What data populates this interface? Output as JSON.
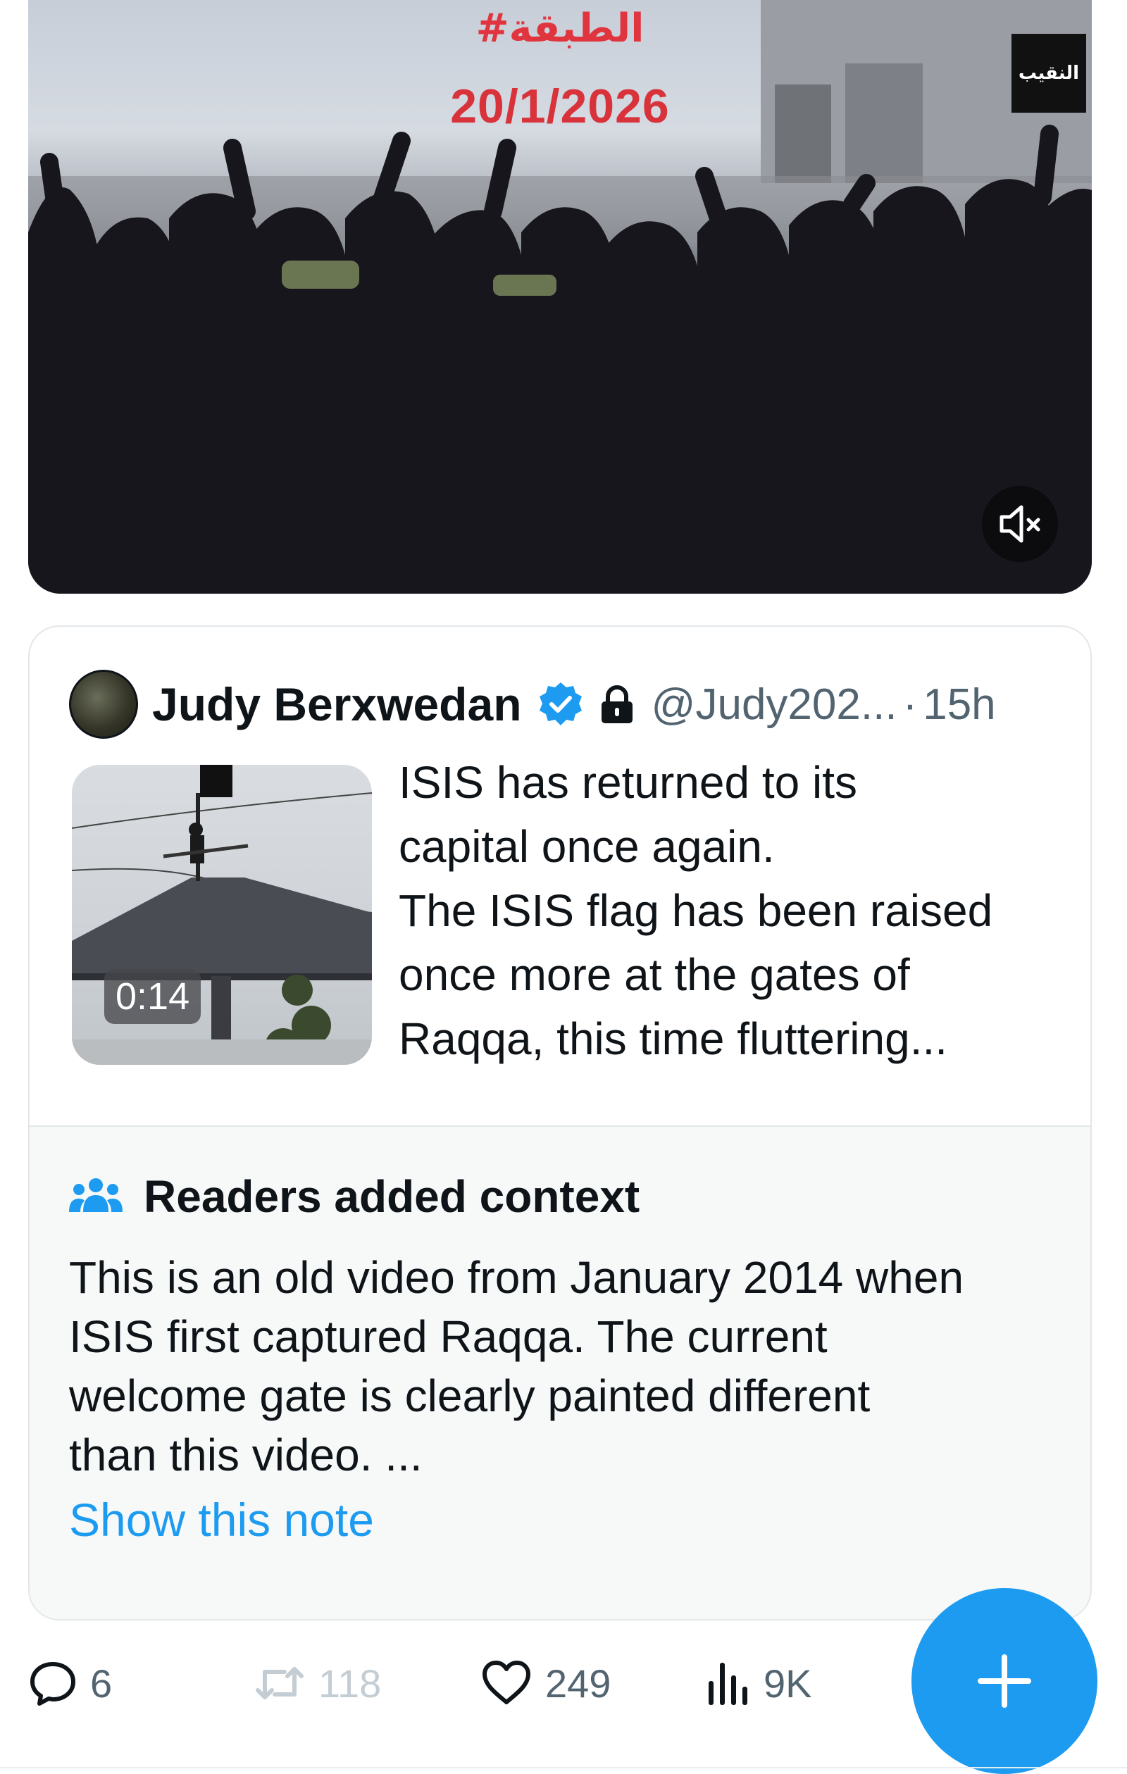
{
  "video": {
    "hashtag": "#الطبقة",
    "date": "20/1/2026",
    "channel_logo": "النقيب",
    "mute_icon": "speaker-muted-icon"
  },
  "quoted_tweet": {
    "author_name": "Judy Berxwedan",
    "verified_icon": "verified-badge-icon",
    "lock_icon": "lock-icon",
    "handle": "@Judy202...",
    "separator": "·",
    "age": "15h",
    "thumbnail_duration": "0:14",
    "text": "ISIS has returned to its\ncapital once again.\nThe ISIS flag has been raised\nonce more at the gates of\nRaqqa, this time fluttering..."
  },
  "community_note": {
    "icon": "people-icon",
    "title": "Readers added context",
    "body": "This is an old video from January 2014 when\nISIS first captured Raqqa. The current\nwelcome gate is clearly painted different\nthan this video. ...",
    "link": "Show this note"
  },
  "actions": {
    "replies": "6",
    "reposts": "118",
    "likes": "249",
    "views": "9K"
  },
  "colors": {
    "accent": "#1d9bf0",
    "text_primary": "#0f1419",
    "text_secondary": "#536471",
    "note_bg": "#f7f9f9",
    "overlay_red": "#d8323b"
  }
}
